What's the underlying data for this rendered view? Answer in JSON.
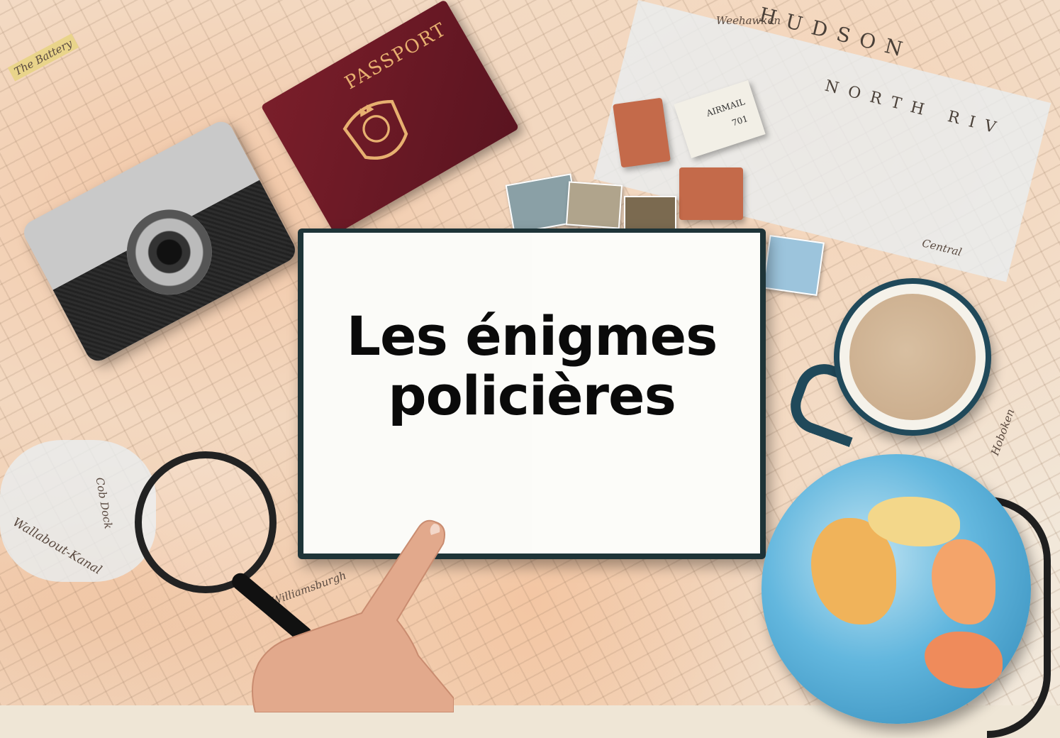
{
  "title": {
    "line1": "Les énigmes",
    "line2": "policières"
  },
  "objects": {
    "passport_text": "PASSPORT",
    "rubber_stamp_text": "AIRMAIL",
    "rubber_stamp_number": "701"
  },
  "map": {
    "river_label": "HUDSON",
    "river_label2": "NORTH RIV",
    "place_labels": [
      "Weehawken",
      "The Battery",
      "Wallabout-Kanal",
      "Cob Dock",
      "Williamsburgh",
      "Central",
      "Hoboken"
    ]
  }
}
